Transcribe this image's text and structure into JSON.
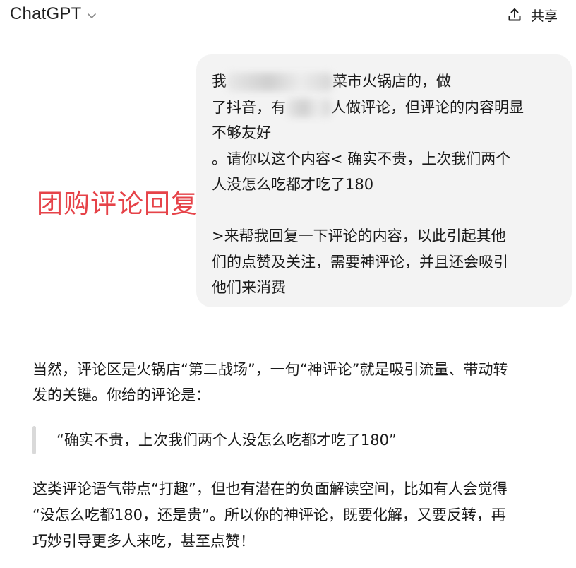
{
  "header": {
    "app_title": "ChatGPT",
    "share_label": "共享"
  },
  "user_message": {
    "lines": [
      "我是...菜市火锅店的，做",
      "了抖音，有...人做评论，但评论的内容明显",
      "不够友好",
      "。请你以这个内容< 确实不贵，上次我们两个",
      "人没怎么吃都才吃了180",
      "",
      ">来帮我回复一下评论的内容，以此引起其他",
      "们的点赞及关注，需要神评论，并且还会吸引",
      "他们来消费"
    ],
    "line1_before": "我",
    "line1_after": "菜市火锅店的，做",
    "line2_before": "了抖音，有",
    "line2_after": "人做评论，但评论的内容明显"
  },
  "overlay_label": "团购评论回复",
  "assistant_response": {
    "para1": [
      "当然，评论区是火锅店“第二战场”，一句“神评论”就是吸引流量、带动转",
      "发的关键。你给的评论是："
    ],
    "quote": "“确实不贵，上次我们两个人没怎么吃都才吃了180”",
    "para2": [
      "这类评论语气带点“打趣”，但也有潜在的负面解读空间，比如有人会觉得",
      "“没怎么吃都180，还是贵”。所以你的神评论，既要化解，又要反转，再",
      "巧妙引导更多人来吃，甚至点赞！"
    ]
  }
}
